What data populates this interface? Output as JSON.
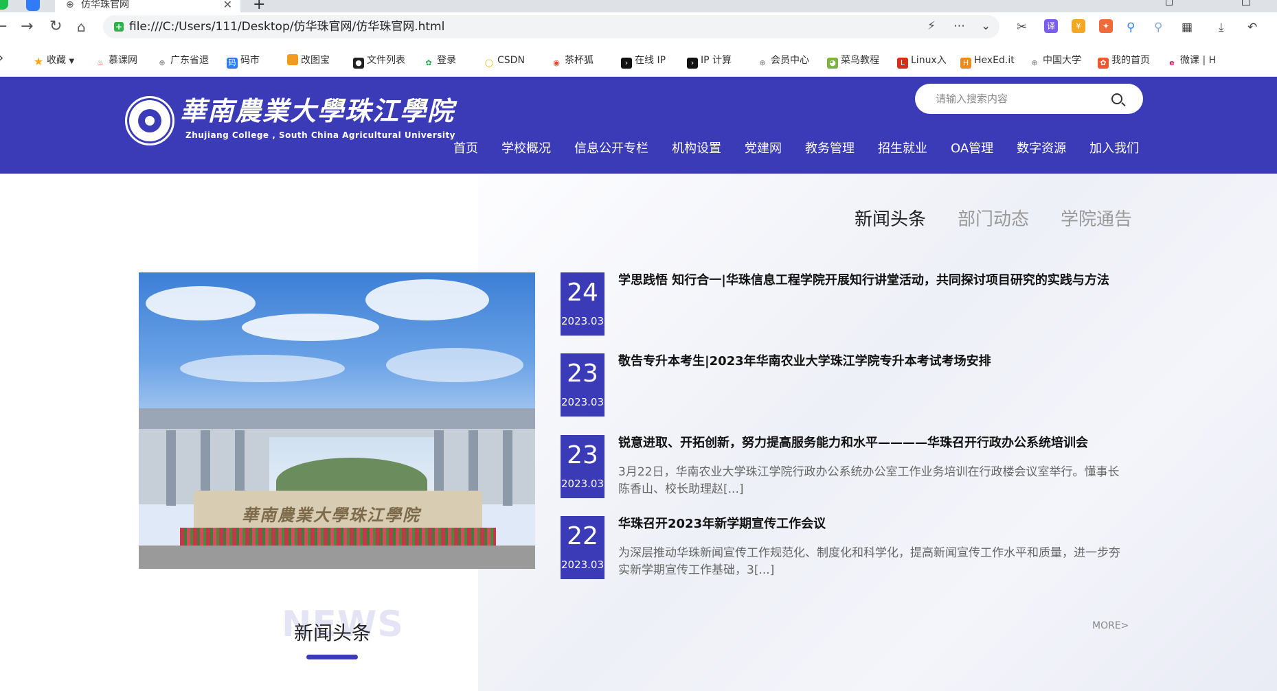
{
  "browser": {
    "tab_title": "仿华珠官网",
    "url": "file:///C:/Users/111/Desktop/仿华珠官网/仿华珠官网.html",
    "bookmarks": [
      {
        "label": "收藏",
        "icon": "star-icon",
        "color": "#f5a623"
      },
      {
        "label": "慕课网",
        "icon": "flame-icon",
        "color": "#e24a2b"
      },
      {
        "label": "广东省退",
        "icon": "globe-icon",
        "color": "#777777"
      },
      {
        "label": "码市",
        "icon": "code-icon",
        "color": "#2f7cf6"
      },
      {
        "label": "改图宝",
        "icon": "image-icon",
        "color": "#f29b1d"
      },
      {
        "label": "文件列表",
        "icon": "cat-icon",
        "color": "#222222"
      },
      {
        "label": "登录",
        "icon": "leaf-icon",
        "color": "#29a745"
      },
      {
        "label": "CSDN",
        "icon": "csdn-icon",
        "color": "#f7b500"
      },
      {
        "label": "茶杯狐",
        "icon": "cup-icon",
        "color": "#e0432b"
      },
      {
        "label": "在线 IP",
        "icon": "terminal-icon",
        "color": "#111111"
      },
      {
        "label": "IP 计算",
        "icon": "terminal-icon",
        "color": "#111111"
      },
      {
        "label": "会员中心",
        "icon": "globe-icon",
        "color": "#777777"
      },
      {
        "label": "菜鸟教程",
        "icon": "bird-icon",
        "color": "#7cb342"
      },
      {
        "label": "Linux入",
        "icon": "linux-icon",
        "color": "#d62c1a"
      },
      {
        "label": "HexEd.it",
        "icon": "hex-icon",
        "color": "#ef8a1a"
      },
      {
        "label": "中国大学",
        "icon": "globe-icon",
        "color": "#777777"
      },
      {
        "label": "我的首页",
        "icon": "home-badge-icon",
        "color": "#f0572d"
      },
      {
        "label": "微课 | H",
        "icon": "edx-icon",
        "color": "#d81b60"
      }
    ]
  },
  "header": {
    "logo_cn": "華南農業大學珠江學院",
    "logo_en": "Zhujiang College , South China Agricultural University",
    "search_placeholder": "请输入搜索内容",
    "nav": [
      "首页",
      "学校概况",
      "信息公开专栏",
      "机构设置",
      "党建网",
      "教务管理",
      "招生就业",
      "OA管理",
      "数字资源",
      "加入我们"
    ],
    "brand_color": "#3b3bb8"
  },
  "news_tabs": [
    {
      "label": "新闻头条",
      "active": true
    },
    {
      "label": "部门动态",
      "active": false
    },
    {
      "label": "学院通告",
      "active": false
    }
  ],
  "news": [
    {
      "day": "24",
      "ym": "2023.03",
      "title": "学思践悟 知行合一|华珠信息工程学院开展知行讲堂活动，共同探讨项目研究的实践与方法",
      "summary": ""
    },
    {
      "day": "23",
      "ym": "2023.03",
      "title": "敬告专升本考生|2023年华南农业大学珠江学院专升本考试考场安排",
      "summary": ""
    },
    {
      "day": "23",
      "ym": "2023.03",
      "title": "锐意进取、开拓创新，努力提高服务能力和水平————华珠召开行政办公系统培训会",
      "summary": "3月22日，华南农业大学珠江学院行政办公系统办公室工作业务培训在行政楼会议室举行。懂事长陈香山、校长助理赵[...]"
    },
    {
      "day": "22",
      "ym": "2023.03",
      "title": "华珠召开2023年新学期宣传工作会议",
      "summary": "为深层推动华珠新闻宣传工作规范化、制度化和科学化，提高新闻宣传工作水平和质量，进一步夯实新学期宣传工作基础，3[...]"
    }
  ],
  "more_label": "MORE>",
  "section": {
    "bg_word": "NEWS",
    "heading": "新闻头条"
  }
}
